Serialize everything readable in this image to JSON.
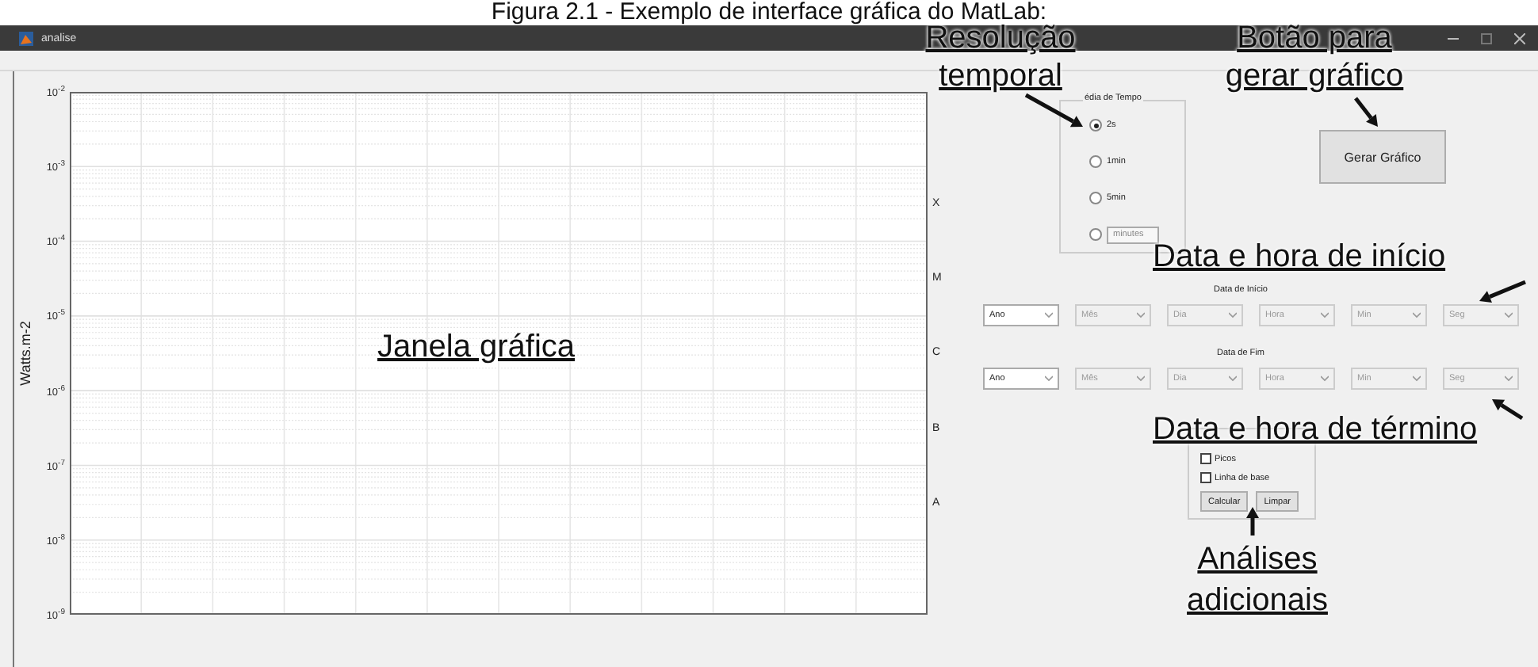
{
  "caption": "Figura 2.1 - Exemplo de interface gráfica do MatLab:",
  "window": {
    "title": "analise"
  },
  "plot": {
    "ylabel": "Watts.m-2",
    "ytick_labels": [
      "10$^{-2}$",
      "10$^{-3}$",
      "10$^{-4}$",
      "10$^{-5}$",
      "10$^{-6}$",
      "10$^{-7}$",
      "10$^{-8}$",
      "10$^{-9}$"
    ],
    "class_labels": [
      "X",
      "M",
      "C",
      "B",
      "A"
    ]
  },
  "time_group": {
    "title": "édia de Tempo",
    "options": [
      {
        "kind": "text",
        "label": "2s",
        "selected": true
      },
      {
        "kind": "text",
        "label": "1min",
        "selected": false
      },
      {
        "kind": "text",
        "label": "5min",
        "selected": false
      },
      {
        "kind": "field",
        "placeholder": "minutes",
        "selected": false
      }
    ]
  },
  "generate_button": "Gerar Gráfico",
  "start": {
    "label": "Data de Início",
    "dropdowns": [
      {
        "label": "Ano",
        "disabled": false
      },
      {
        "label": "Mês",
        "disabled": true
      },
      {
        "label": "Dia",
        "disabled": true
      },
      {
        "label": "Hora",
        "disabled": true
      },
      {
        "label": "Min",
        "disabled": true
      },
      {
        "label": "Seg",
        "disabled": true
      }
    ]
  },
  "end": {
    "label": "Data de Fim",
    "dropdowns": [
      {
        "label": "Ano",
        "disabled": false
      },
      {
        "label": "Mês",
        "disabled": true
      },
      {
        "label": "Dia",
        "disabled": true
      },
      {
        "label": "Hora",
        "disabled": true
      },
      {
        "label": "Min",
        "disabled": true
      },
      {
        "label": "Seg",
        "disabled": true
      }
    ]
  },
  "analysis": {
    "checkboxes": [
      {
        "label": "Picos",
        "checked": false
      },
      {
        "label": "Linha de base",
        "checked": false
      }
    ],
    "buttons": [
      "Calcular",
      "Limpar"
    ]
  },
  "annotations": [
    {
      "text": "Resolução\ntemporal"
    },
    {
      "text": "Botão para\ngerar gráfico"
    },
    {
      "text": "Janela gráfica"
    },
    {
      "text": "Data e hora de início"
    },
    {
      "text": "Data e hora de término"
    },
    {
      "text": "Análises\nadicionais"
    }
  ]
}
